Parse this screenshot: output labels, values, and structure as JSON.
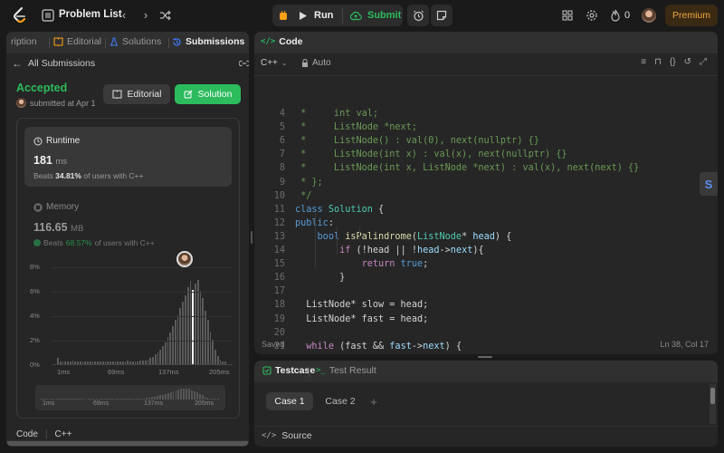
{
  "topbar": {
    "problem_list": "Problem List",
    "run": "Run",
    "submit": "Submit",
    "streak": "0",
    "premium": "Premium",
    "colors": {
      "submit": "#2cbb5d",
      "premium": "#f0a93a",
      "accent": "#ffa116"
    }
  },
  "left_tabs": {
    "description_partial": "ription",
    "editorial": "Editorial",
    "solutions": "Solutions",
    "submissions": "Submissions"
  },
  "submission": {
    "back_label": "All Submissions",
    "status": "Accepted",
    "submitted": "submitted at Apr 1",
    "editorial_btn": "Editorial",
    "solution_btn": "Solution",
    "runtime_label": "Runtime",
    "runtime_value": "181",
    "runtime_unit": "ms",
    "runtime_beats_prefix": "Beats",
    "runtime_beats_pct": "34.81%",
    "runtime_beats_suffix": "of users with C++",
    "memory_label": "Memory",
    "memory_value": "116.65",
    "memory_unit": "MB",
    "memory_beats_prefix": "Beats",
    "memory_beats_pct": "68.57%",
    "memory_beats_suffix": "of users with C++",
    "bottom_code": "Code",
    "bottom_lang": "C++"
  },
  "chart_data": {
    "type": "bar",
    "y_ticks": [
      "8%",
      "6%",
      "4%",
      "2%",
      "0%"
    ],
    "ylim": [
      0,
      8
    ],
    "x_ticks": [
      "1ms",
      "69ms",
      "137ms",
      "205ms"
    ],
    "mini_x_ticks": [
      "1ms",
      "69ms",
      "137ms",
      "205ms"
    ],
    "values": [
      0.5,
      0.2,
      0.2,
      0.2,
      0.2,
      0.2,
      0.3,
      0.2,
      0.2,
      0.2,
      0.2,
      0.2,
      0.2,
      0.2,
      0.2,
      0.2,
      0.2,
      0.2,
      0.2,
      0.2,
      0.2,
      0.2,
      0.2,
      0.2,
      0.2,
      0.2,
      0.2,
      0.2,
      0.3,
      0.2,
      0.2,
      0.2,
      0.2,
      0.3,
      0.3,
      0.3,
      0.4,
      0.5,
      0.6,
      0.8,
      1.0,
      1.2,
      1.5,
      1.8,
      2.2,
      2.6,
      3.1,
      3.6,
      4.0,
      4.6,
      5.1,
      5.6,
      6.3,
      6.8,
      7.0,
      6.6,
      6.9,
      6.0,
      5.4,
      4.4,
      3.6,
      2.7,
      2.0,
      1.2,
      0.7,
      0.4,
      0.2,
      0.2
    ],
    "selected_index": 54,
    "selected_color": "#ffffff",
    "bar_color": "#5a5a5a"
  },
  "code_panel": {
    "title": "Code",
    "language": "C++",
    "auto": "Auto",
    "status": "Saved",
    "cursor": "Ln 38, Col 17",
    "lines": [
      {
        "n": "4",
        "html": "<span class='cm'> *     int val;</span>"
      },
      {
        "n": "5",
        "html": "<span class='cm'> *     ListNode *next;</span>"
      },
      {
        "n": "6",
        "html": "<span class='cm'> *     ListNode() : val(0), next(nullptr) {}</span>"
      },
      {
        "n": "7",
        "html": "<span class='cm'> *     ListNode(int x) : val(x), next(nullptr) {}</span>"
      },
      {
        "n": "8",
        "html": "<span class='cm'> *     ListNode(int x, ListNode *next) : val(x), next(next) {}</span>"
      },
      {
        "n": "9",
        "html": "<span class='cm'> * };</span>"
      },
      {
        "n": "10",
        "html": "<span class='cm'> */</span>"
      },
      {
        "n": "11",
        "html": "<span class='bl'>class</span> <span class='ty'>Solution</span> <span class='pl'>{</span>"
      },
      {
        "n": "12",
        "html": "<span class='bl'>public</span><span class='pl'>:</span>"
      },
      {
        "n": "13",
        "html": "    <span class='bl'>bool</span> <span class='fn'>isPalindrome</span><span class='pl'>(</span><span class='ty'>ListNode</span><span class='pl'>*</span> <span class='vr'>head</span><span class='pl'>) {</span>"
      },
      {
        "n": "14",
        "html": "        <span class='kw'>if</span> <span class='pl'>(!head || !</span><span class='vr'>head</span><span class='pl'>-&gt;</span><span class='vr'>next</span><span class='pl'>){</span>"
      },
      {
        "n": "15",
        "html": "            <span class='kw'>return</span> <span class='bl'>true</span><span class='pl'>;</span>"
      },
      {
        "n": "16",
        "html": "        <span class='pl'>}</span>"
      },
      {
        "n": "17",
        "html": ""
      },
      {
        "n": "18",
        "html": "  <span class='pl'>ListNode* slow = head;</span>"
      },
      {
        "n": "19",
        "html": "  <span class='pl'>ListNode* fast = head;</span>"
      },
      {
        "n": "20",
        "html": ""
      },
      {
        "n": "21",
        "html": "  <span class='kw'>while</span> <span class='pl'>(fast &amp;&amp; </span><span class='vr'>fast</span><span class='pl'>-&gt;</span><span class='vr'>next</span><span class='pl'>) {</span>"
      }
    ]
  },
  "testcase": {
    "tab_testcase": "Testcase",
    "tab_result": "Test Result",
    "case1": "Case 1",
    "case2": "Case 2",
    "add": "+",
    "source": "Source"
  }
}
